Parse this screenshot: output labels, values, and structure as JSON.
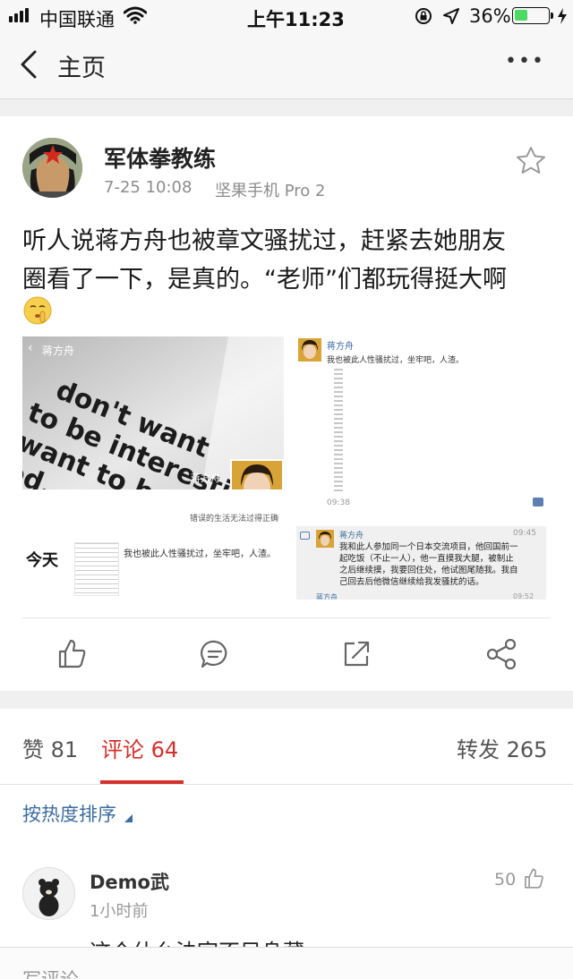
{
  "status_bar": {
    "carrier": "中国联通",
    "time": "上午11:23",
    "battery": "36%"
  },
  "nav": {
    "back_label": "主页",
    "more_label": "•••"
  },
  "post": {
    "author": "军体拳教练",
    "time": "7-25 10:08",
    "device": "坚果手机 Pro 2",
    "text_line1": "听人说蒋方舟也被章文骚扰过，赶紧去她朋友",
    "text_line2": "圈看了一下，是真的。“老师”们都玩得挺大啊"
  },
  "images": {
    "img1": {
      "back_name": "蒋方舟",
      "quote": [
        "don't want",
        "to be interesting",
        "I want to be",
        "good."
      ],
      "small_name": "蒋方舟",
      "caption": "错误的生活无法过得正确"
    },
    "img2": {
      "name": "蒋方舟",
      "message": "我也被此人性骚扰过，坐牢吧，人渣。",
      "time": "09:38"
    },
    "img3": {
      "today": "今天",
      "message": "我也被此人性骚扰过，坐牢吧，人渣。"
    },
    "img4": {
      "name": "蒋方舟",
      "time": "09:45",
      "lines": [
        "我和此人参加同一个日本交流项目，他回国前一",
        "起吃饭（不止一人），他一直摸我大腿，被制止",
        "之后继续摸，我要回住处，他试图尾随我。我自",
        "己回去后他微信继续给我发骚扰的话。"
      ],
      "next_name": "蒋方舟",
      "next_time": "09:52"
    }
  },
  "tabs": {
    "likes": "赞 81",
    "comments": "评论 64",
    "reposts": "转发 265"
  },
  "sort_label": "按热度排序",
  "comment": {
    "author": "Demo武",
    "time": "1小时前",
    "likes": "50",
    "text_partial": "这个什么法官不目身藏"
  },
  "comment_input": {
    "placeholder": "写评论..."
  },
  "colors": {
    "accent_red": "#d2312c",
    "link_blue": "#3c6d9e",
    "battery_green": "#4cd964"
  }
}
